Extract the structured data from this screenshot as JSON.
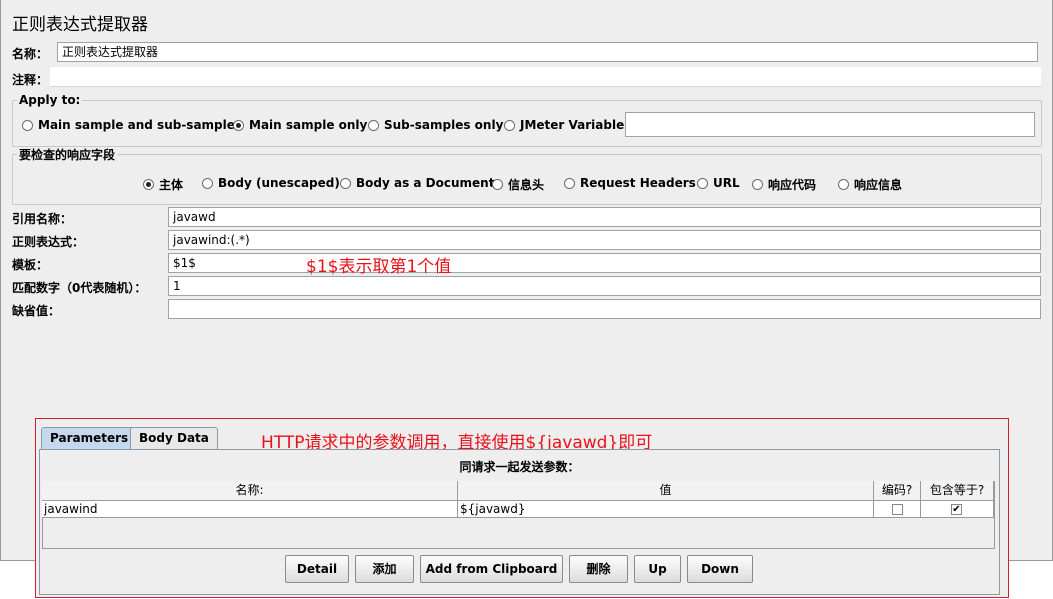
{
  "header": {
    "title": "正则表达式提取器"
  },
  "name_row": {
    "label": "名称：",
    "value": "正则表达式提取器"
  },
  "comment_row": {
    "label": "注释：",
    "value": ""
  },
  "apply_to": {
    "legend": "Apply to:",
    "options": [
      "Main sample and sub-samples",
      "Main sample only",
      "Sub-samples only",
      "JMeter Variable"
    ],
    "selected": "Main sample only",
    "variable_value": ""
  },
  "response_field": {
    "legend": "要检查的响应字段",
    "options": [
      "主体",
      "Body (unescaped)",
      "Body as a Document",
      "信息头",
      "Request Headers",
      "URL",
      "响应代码",
      "响应信息"
    ],
    "selected": "主体"
  },
  "form": {
    "ref_name": {
      "label": "引用名称：",
      "value": "javawd"
    },
    "regex": {
      "label": "正则表达式：",
      "value": "javawind:(.*)"
    },
    "template": {
      "label": "模板：",
      "value": "$1$"
    },
    "match_no": {
      "label": "匹配数字（0代表随机）：",
      "value": "1"
    },
    "default": {
      "label": "缺省值：",
      "value": ""
    }
  },
  "annotations": {
    "template_note": "$1$表示取第1个值",
    "http_note": "HTTP请求中的参数调用，直接使用${javawd}即可",
    "color": "#e8121a"
  },
  "tabs": [
    {
      "label": "Parameters",
      "active": true
    },
    {
      "label": "Body Data",
      "active": false
    }
  ],
  "params": {
    "caption": "同请求一起发送参数：",
    "columns": [
      "名称:",
      "值",
      "编码?",
      "包含等于?"
    ],
    "rows": [
      {
        "name": "javawind",
        "value": "${javawd}",
        "encode": false,
        "include_equals": true
      }
    ]
  },
  "buttons": [
    "Detail",
    "添加",
    "Add from Clipboard",
    "删除",
    "Up",
    "Down"
  ]
}
